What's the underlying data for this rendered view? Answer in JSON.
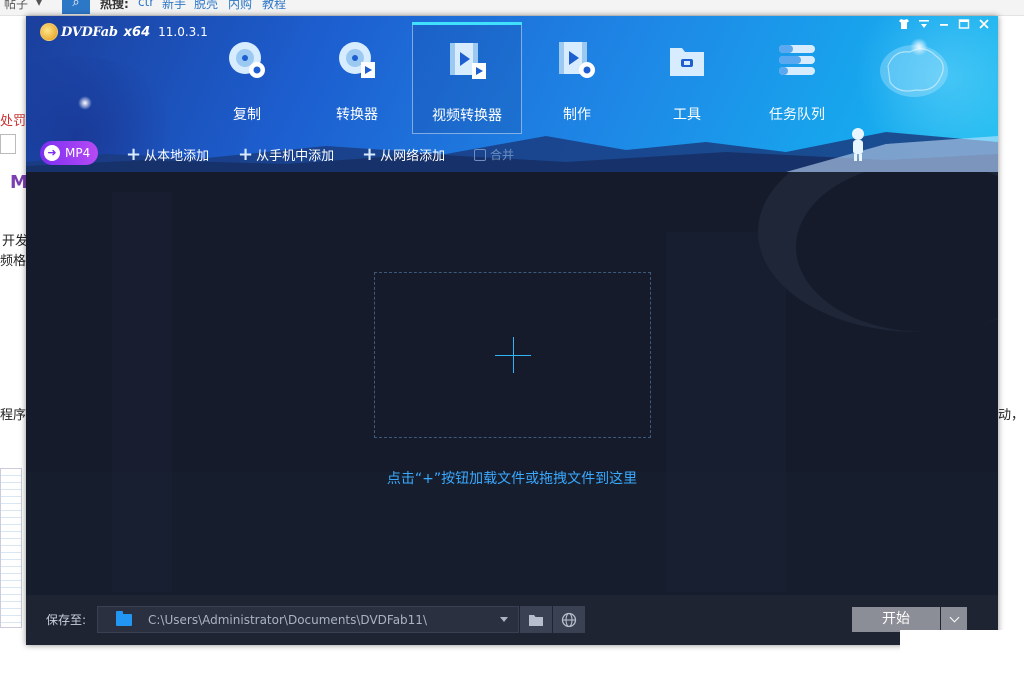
{
  "background_page": {
    "top_texts": [
      "帖子",
      "热搜:",
      "ctr",
      "新手",
      "脱壳",
      "内购",
      "教程"
    ],
    "snippets": {
      "punish": "处罚",
      "logo_letter": "M",
      "dev": "开发",
      "format": "频格",
      "program": "程序会",
      "right": "动，以"
    }
  },
  "app": {
    "brand_name": "DVDFab",
    "arch": "x64",
    "version": "11.0.3.1",
    "nav": [
      {
        "label": "复制",
        "icon": "disc-copy-icon"
      },
      {
        "label": "转换器",
        "icon": "disc-convert-icon"
      },
      {
        "label": "视频转换器",
        "icon": "video-convert-icon",
        "active": true
      },
      {
        "label": "制作",
        "icon": "video-create-icon"
      },
      {
        "label": "工具",
        "icon": "toolbox-icon"
      },
      {
        "label": "任务队列",
        "icon": "task-queue-icon"
      }
    ],
    "profile_button": "MP4",
    "add_local": "从本地添加",
    "add_phone": "从手机中添加",
    "add_network": "从网络添加",
    "merge": "合并",
    "drop_hint": "点击“+”按钮加载文件或拖拽文件到这里",
    "save_label": "保存至:",
    "save_path": "C:\\Users\\Administrator\\Documents\\DVDFab11\\",
    "start_button": "开始",
    "colors": {
      "accent": "#2fb5f5",
      "mp4_start": "#7b2ff0",
      "mp4_end": "#b74af5",
      "start_button": "#8b8e96"
    }
  }
}
